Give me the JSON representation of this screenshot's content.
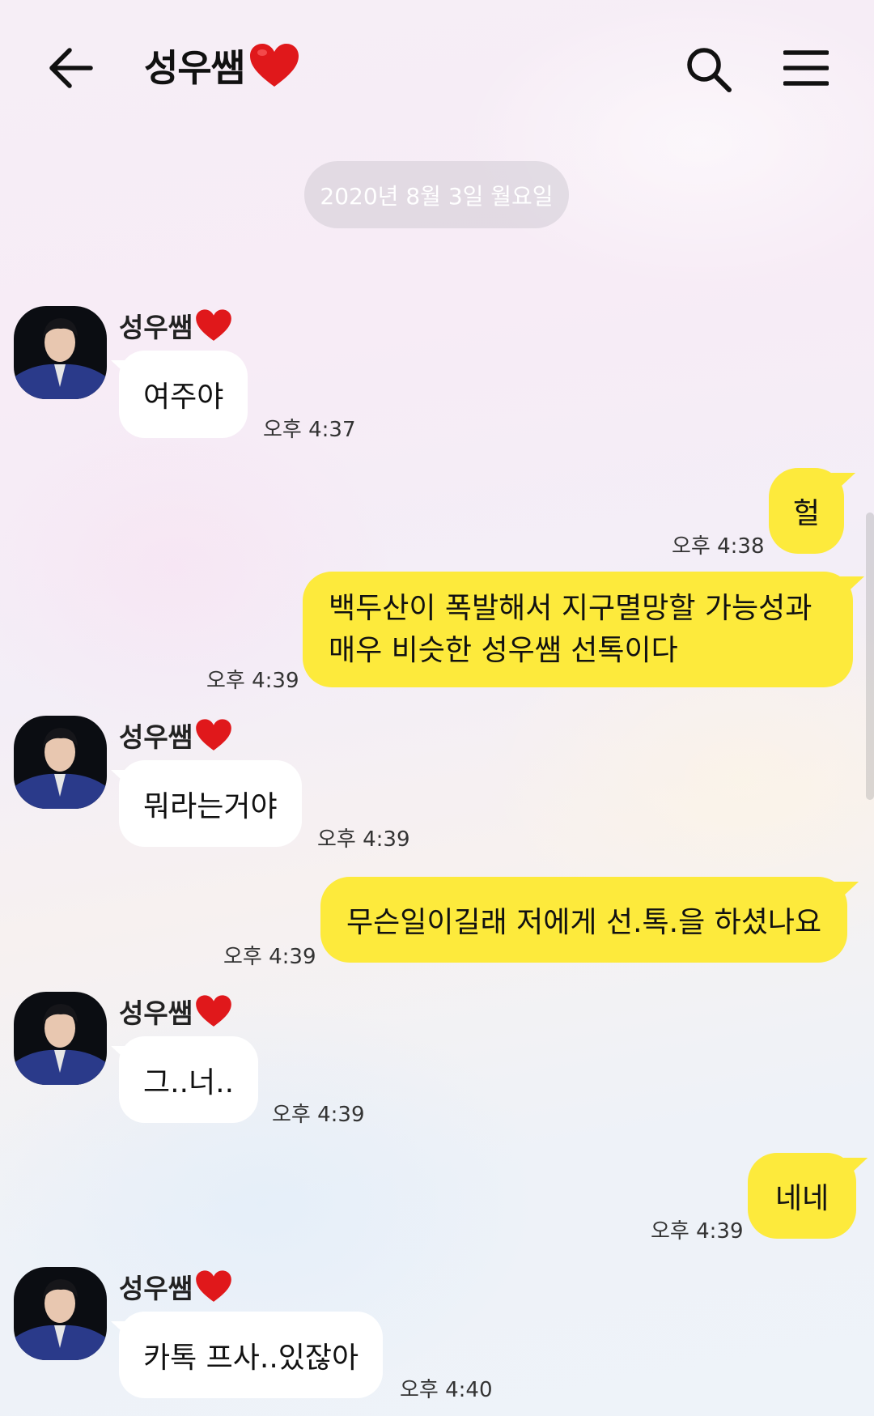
{
  "header": {
    "title": "성우쌤",
    "back_icon": "back-arrow-icon",
    "search_icon": "search-icon",
    "menu_icon": "hamburger-menu-icon"
  },
  "date_divider": "2020년 8월 3일 월요일",
  "colors": {
    "outgoing_bubble": "#fdea3c",
    "incoming_bubble": "#ffffff",
    "heart": "#e0181b"
  },
  "messages": [
    {
      "direction": "in",
      "sender": "성우쌤",
      "text": "여주야",
      "time": "오후 4:37"
    },
    {
      "direction": "out",
      "text": "헐",
      "time": "오후 4:38"
    },
    {
      "direction": "out",
      "text": "백두산이 폭발해서 지구멸망할 가능성과 매우 비슷한 성우쌤 선톡이다",
      "time": "오후 4:39"
    },
    {
      "direction": "in",
      "sender": "성우쌤",
      "text": "뭐라는거야",
      "time": "오후 4:39"
    },
    {
      "direction": "out",
      "text": "무슨일이길래 저에게 선.톡.을 하셨나요",
      "time": "오후 4:39"
    },
    {
      "direction": "in",
      "sender": "성우쌤",
      "text": "그..너..",
      "time": "오후 4:39"
    },
    {
      "direction": "out",
      "text": "네네",
      "time": "오후 4:39"
    },
    {
      "direction": "in",
      "sender": "성우쌤",
      "text": "카톡 프사..있잖아",
      "time": "오후 4:40"
    }
  ]
}
